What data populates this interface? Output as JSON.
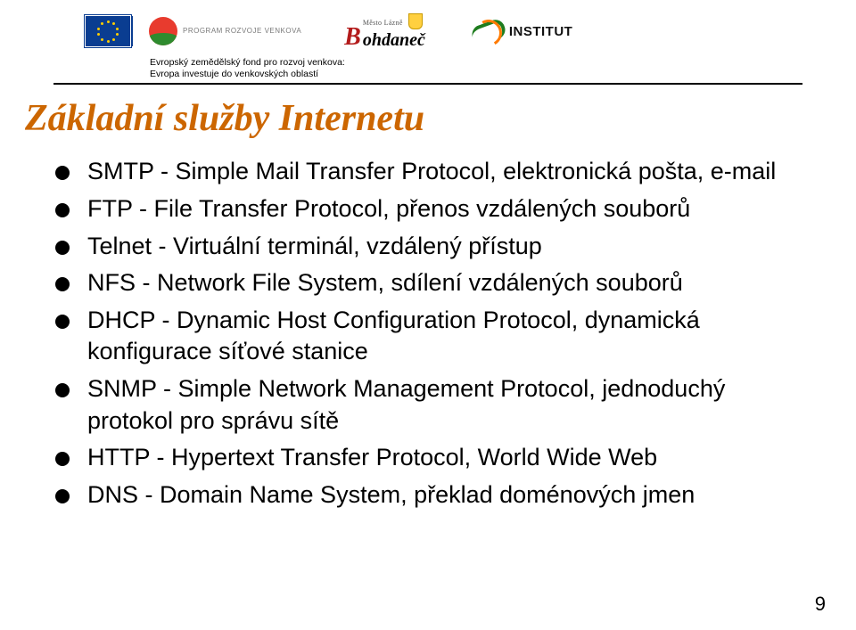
{
  "header": {
    "prv_label": "PROGRAM ROZVOJE VENKOVA",
    "bohdanec_top": "Město Lázně",
    "bohdanec_name": "ohdaneč",
    "institut_label": "INSTITUT",
    "fund_line1": "Evropský zemědělský fond pro rozvoj venkova:",
    "fund_line2": "Evropa investuje do venkovských oblastí"
  },
  "title": "Základní služby Internetu",
  "bullets": [
    "SMTP - Simple Mail Transfer Protocol, elektronická pošta, e-mail",
    "FTP - File Transfer Protocol, přenos vzdálených souborů",
    "Telnet - Virtuální terminál, vzdálený přístup",
    "NFS - Network File System, sdílení vzdálených souborů",
    "DHCP - Dynamic Host Configuration Protocol, dynamická konfigurace síťové stanice",
    "SNMP - Simple Network Management Protocol, jednoduchý protokol pro správu sítě",
    "HTTP - Hypertext Transfer Protocol, World Wide Web",
    "DNS - Domain Name System, překlad doménových jmen"
  ],
  "page_number": "9"
}
